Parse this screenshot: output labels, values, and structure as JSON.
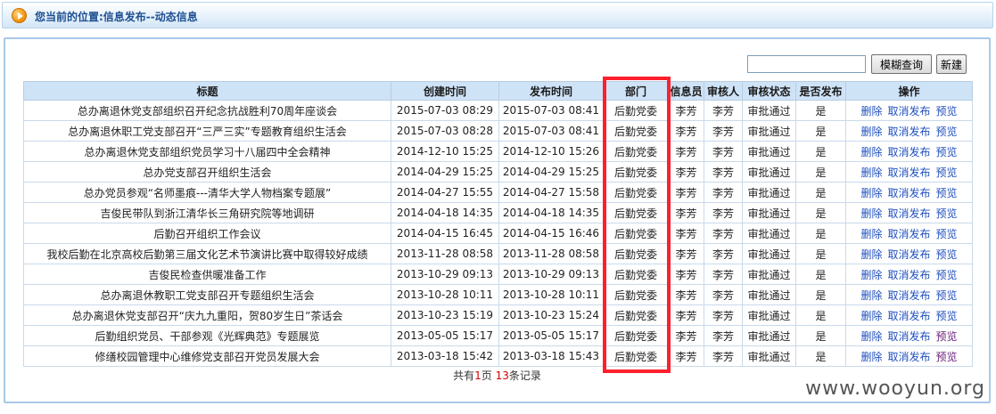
{
  "breadcrumb": {
    "text": "您当前的位置:信息发布--动态信息"
  },
  "search": {
    "value": "",
    "placeholder": "",
    "query_label": "模糊查询",
    "create_label": "新建"
  },
  "table": {
    "headers": [
      "标题",
      "创建时间",
      "发布时间",
      "部门",
      "信息员",
      "审核人",
      "审核状态",
      "是否发布",
      "操作"
    ],
    "rows": [
      {
        "title": "总办离退休党支部组织召开纪念抗战胜利70周年座谈会",
        "created": "2015-07-03 08:29",
        "published": "2015-07-03 08:41",
        "dept": "后勤党委",
        "reporter": "李芳",
        "reviewer": "李芳",
        "status": "审批通过",
        "is_published": "是",
        "ops": {
          "delete": "删除",
          "cancel": "取消发布",
          "preview": "预览"
        }
      },
      {
        "title": "总办离退休职工党支部召开“三严三实”专题教育组织生活会",
        "created": "2015-07-03 08:28",
        "published": "2015-07-03 08:41",
        "dept": "后勤党委",
        "reporter": "李芳",
        "reviewer": "李芳",
        "status": "审批通过",
        "is_published": "是",
        "ops": {
          "delete": "删除",
          "cancel": "取消发布",
          "preview": "预览"
        }
      },
      {
        "title": "总办离退休党支部组织党员学习十八届四中全会精神",
        "created": "2014-12-10 15:25",
        "published": "2014-12-10 15:26",
        "dept": "后勤党委",
        "reporter": "李芳",
        "reviewer": "李芳",
        "status": "审批通过",
        "is_published": "是",
        "ops": {
          "delete": "删除",
          "cancel": "取消发布",
          "preview": "预览"
        }
      },
      {
        "title": "总办党支部召开组织生活会",
        "created": "2014-04-29 15:25",
        "published": "2014-04-29 15:25",
        "dept": "后勤党委",
        "reporter": "李芳",
        "reviewer": "李芳",
        "status": "审批通过",
        "is_published": "是",
        "ops": {
          "delete": "删除",
          "cancel": "取消发布",
          "preview": "预览"
        }
      },
      {
        "title": "总办党员参观“名师墨痕---清华大学人物档案专题展”",
        "created": "2014-04-27 15:55",
        "published": "2014-04-27 15:58",
        "dept": "后勤党委",
        "reporter": "李芳",
        "reviewer": "李芳",
        "status": "审批通过",
        "is_published": "是",
        "ops": {
          "delete": "删除",
          "cancel": "取消发布",
          "preview": "预览"
        }
      },
      {
        "title": "吉俊民带队到浙江清华长三角研究院等地调研",
        "created": "2014-04-18 14:35",
        "published": "2014-04-18 14:35",
        "dept": "后勤党委",
        "reporter": "李芳",
        "reviewer": "李芳",
        "status": "审批通过",
        "is_published": "是",
        "ops": {
          "delete": "删除",
          "cancel": "取消发布",
          "preview": "预览"
        }
      },
      {
        "title": "后勤召开组织工作会议",
        "created": "2014-04-15 16:45",
        "published": "2014-04-15 16:46",
        "dept": "后勤党委",
        "reporter": "李芳",
        "reviewer": "李芳",
        "status": "审批通过",
        "is_published": "是",
        "ops": {
          "delete": "删除",
          "cancel": "取消发布",
          "preview": "预览"
        }
      },
      {
        "title": "我校后勤在北京高校后勤第三届文化艺术节演讲比赛中取得较好成绩",
        "created": "2013-11-28 08:58",
        "published": "2013-11-28 08:58",
        "dept": "后勤党委",
        "reporter": "李芳",
        "reviewer": "李芳",
        "status": "审批通过",
        "is_published": "是",
        "ops": {
          "delete": "删除",
          "cancel": "取消发布",
          "preview": "预览"
        }
      },
      {
        "title": "吉俊民检查供暖准备工作",
        "created": "2013-10-29 09:13",
        "published": "2013-10-29 09:13",
        "dept": "后勤党委",
        "reporter": "李芳",
        "reviewer": "李芳",
        "status": "审批通过",
        "is_published": "是",
        "ops": {
          "delete": "删除",
          "cancel": "取消发布",
          "preview": "预览"
        }
      },
      {
        "title": "总办离退休教职工党支部召开专题组织生活会",
        "created": "2013-10-28 10:11",
        "published": "2013-10-28 10:11",
        "dept": "后勤党委",
        "reporter": "李芳",
        "reviewer": "李芳",
        "status": "审批通过",
        "is_published": "是",
        "ops": {
          "delete": "删除",
          "cancel": "取消发布",
          "preview": "预览"
        }
      },
      {
        "title": "总办离退休党支部召开“庆九九重阳，贺80岁生日”茶话会",
        "created": "2013-10-23 15:19",
        "published": "2013-10-23 15:24",
        "dept": "后勤党委",
        "reporter": "李芳",
        "reviewer": "李芳",
        "status": "审批通过",
        "is_published": "是",
        "ops": {
          "delete": "删除",
          "cancel": "取消发布",
          "preview": "预览"
        }
      },
      {
        "title": "后勤组织党员、干部参观《光辉典范》专题展览",
        "created": "2013-05-05 15:17",
        "published": "2013-05-05 15:17",
        "dept": "后勤党委",
        "reporter": "李芳",
        "reviewer": "李芳",
        "status": "审批通过",
        "is_published": "是",
        "ops": {
          "delete": "删除",
          "cancel": "取消发布",
          "preview": "预览"
        }
      },
      {
        "title": "修缮校园管理中心维修党支部召开党员发展大会",
        "created": "2013-03-18 15:42",
        "published": "2013-03-18 15:43",
        "dept": "后勤党委",
        "reporter": "李芳",
        "reviewer": "李芳",
        "status": "审批通过",
        "is_published": "是",
        "ops": {
          "delete": "删除",
          "cancel": "取消发布",
          "preview": "预览"
        }
      }
    ]
  },
  "pager": {
    "prefix": "共有",
    "pages": "1",
    "mid": "页 ",
    "count": "13",
    "suffix": "条记录"
  },
  "watermark": {
    "text": "www.wooyun.org"
  },
  "colors": {
    "highlight": "#ff1f2d",
    "header_bg": "#cfe3f7",
    "link": "#1f4fbf",
    "visited_link": "#6b1d7a"
  }
}
